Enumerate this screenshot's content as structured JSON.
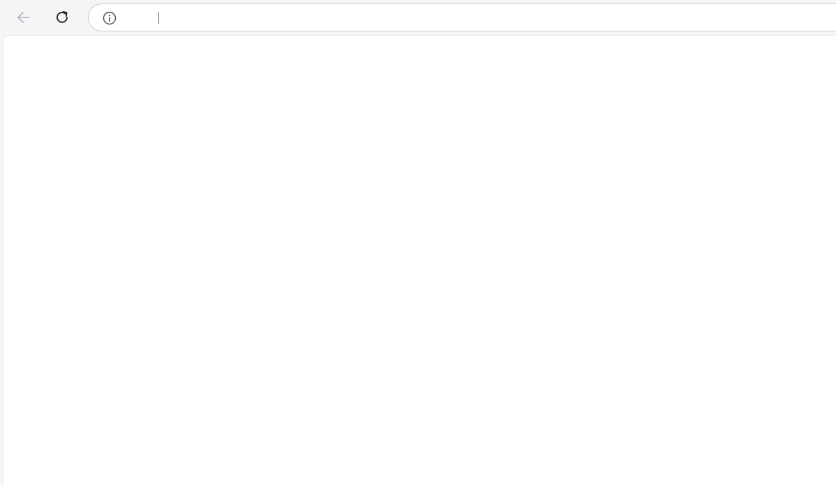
{
  "browser": {
    "site_label": "",
    "url": ""
  },
  "page": {
    "paragraph_class": "",
    "paragraph_plain": "",
    "paragraph_class_2": "",
    "div_class": ""
  },
  "colors": {
    "class_text": "#b9b8f9",
    "p_text": "#f7b6c6",
    "p_class_text": "#bcbcbc"
  },
  "icons": {
    "back": "arrow-left-icon",
    "reload": "reload-icon",
    "info": "info-icon"
  }
}
